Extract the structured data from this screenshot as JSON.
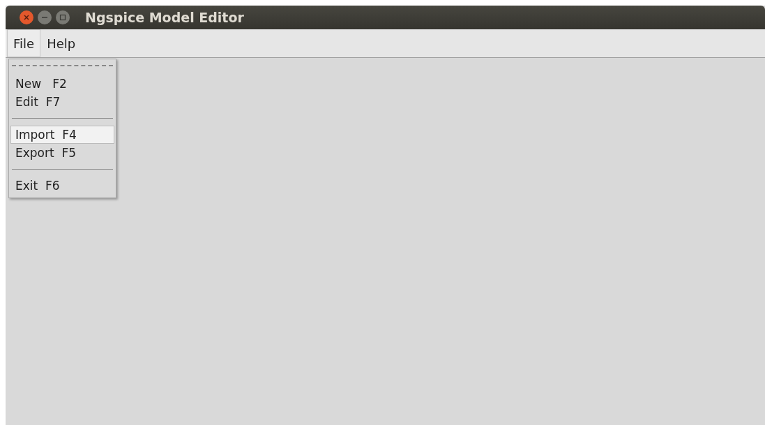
{
  "window": {
    "title": "Ngspice Model Editor"
  },
  "menubar": [
    {
      "label": "File",
      "selected": true
    },
    {
      "label": "Help",
      "selected": false
    }
  ],
  "file_menu": [
    {
      "kind": "tearoff"
    },
    {
      "kind": "item",
      "label": "New   F2",
      "selected": false
    },
    {
      "kind": "item",
      "label": "Edit  F7",
      "selected": false
    },
    {
      "kind": "separator"
    },
    {
      "kind": "item",
      "label": "Import  F4",
      "selected": true
    },
    {
      "kind": "item",
      "label": "Export  F5",
      "selected": false
    },
    {
      "kind": "separator"
    },
    {
      "kind": "item",
      "label": "Exit  F6",
      "selected": false
    }
  ]
}
